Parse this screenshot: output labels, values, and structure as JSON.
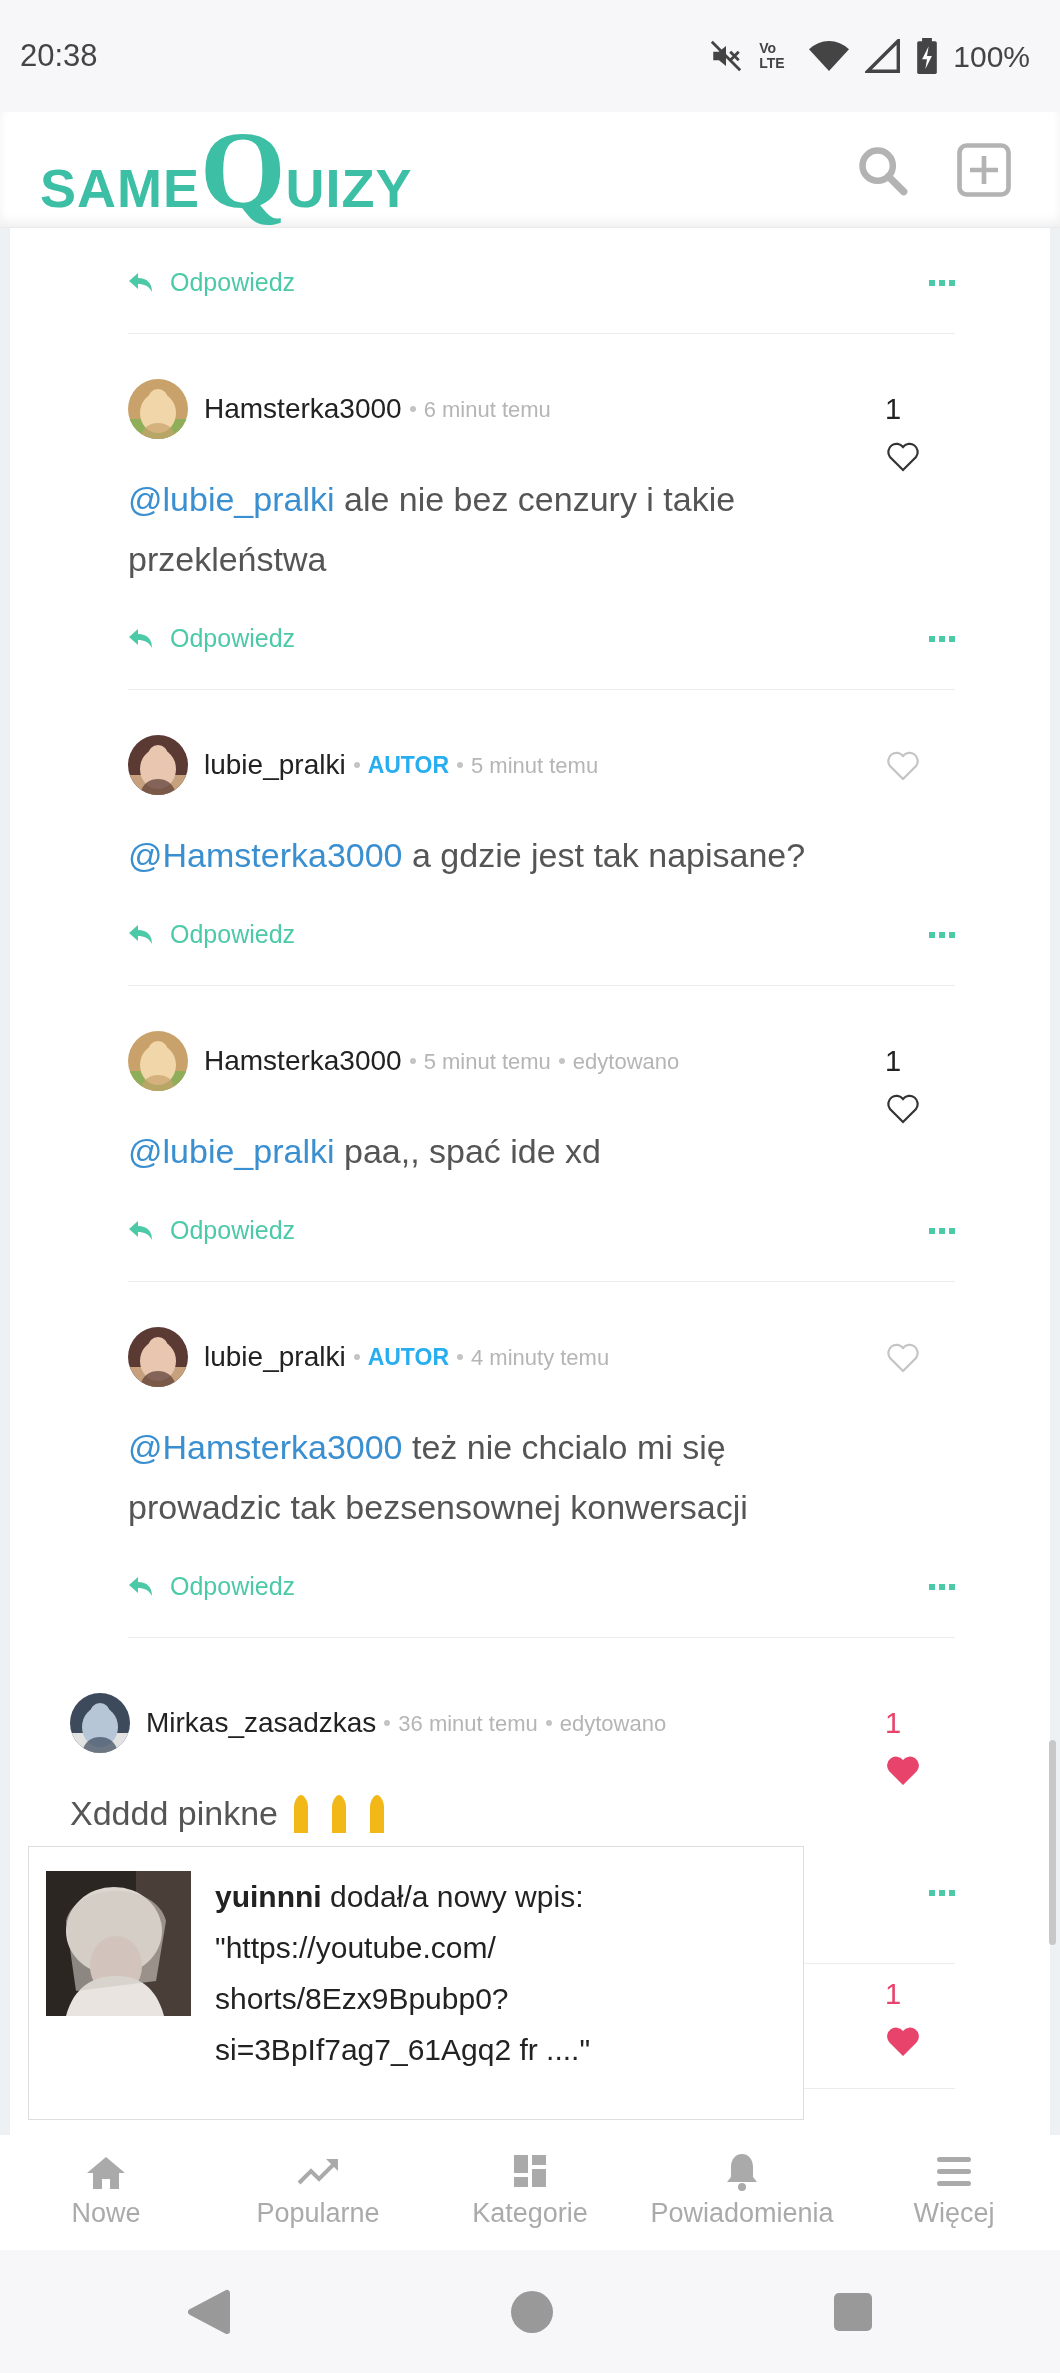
{
  "status_bar": {
    "time": "20:38",
    "network": "Vo LTE",
    "battery": "100%"
  },
  "header": {
    "logo": [
      "SAME",
      "Q",
      "UIZY"
    ]
  },
  "thread": {
    "top_reply_label": "Odpowiedz",
    "replies": [
      {
        "author": "Hamsterka3000",
        "time": "6 minut temu",
        "mention": "@lubie_pralki",
        "body": "ale nie bez cenzury i takie przekleństwa",
        "likes": "1",
        "liked": false,
        "reply_label": "Odpowiedz"
      },
      {
        "author": "lubie_pralki",
        "badge": "AUTOR",
        "time": "5 minut temu",
        "mention": "@Hamsterka3000",
        "body": "a gdzie jest tak napisane?",
        "liked": false,
        "reply_label": "Odpowiedz"
      },
      {
        "author": "Hamsterka3000",
        "time": "5 minut temu",
        "edited": "edytowano",
        "mention": "@lubie_pralki",
        "body": "paa,, spać ide xd",
        "likes": "1",
        "liked": false,
        "reply_label": "Odpowiedz"
      },
      {
        "author": "lubie_pralki",
        "badge": "AUTOR",
        "time": "4 minuty temu",
        "mention": "@Hamsterka3000",
        "body": "też nie chcialo mi się prowadzic tak bezsensownej konwersacji",
        "liked": false,
        "reply_label": "Odpowiedz"
      }
    ],
    "comments": [
      {
        "author": "Mirkas_zasadzkas",
        "time": "36 minut temu",
        "edited": "edytowano",
        "body": "Xdddd pinkne",
        "likes": "1",
        "liked": true
      },
      {
        "likes": "1",
        "liked": true
      }
    ]
  },
  "notification": {
    "lines": [
      "**yuinnni** dodał/a nowy wpis:",
      "\"https://youtube.com/",
      "shorts/8Ezx9Bpubp0?",
      "si=3BpIf7ag7_61Agq2 fr ....\""
    ]
  },
  "bottom_nav": [
    {
      "label": "Nowe"
    },
    {
      "label": "Popularne"
    },
    {
      "label": "Kategorie"
    },
    {
      "label": "Powiadomienia"
    },
    {
      "label": "Więcej"
    }
  ]
}
